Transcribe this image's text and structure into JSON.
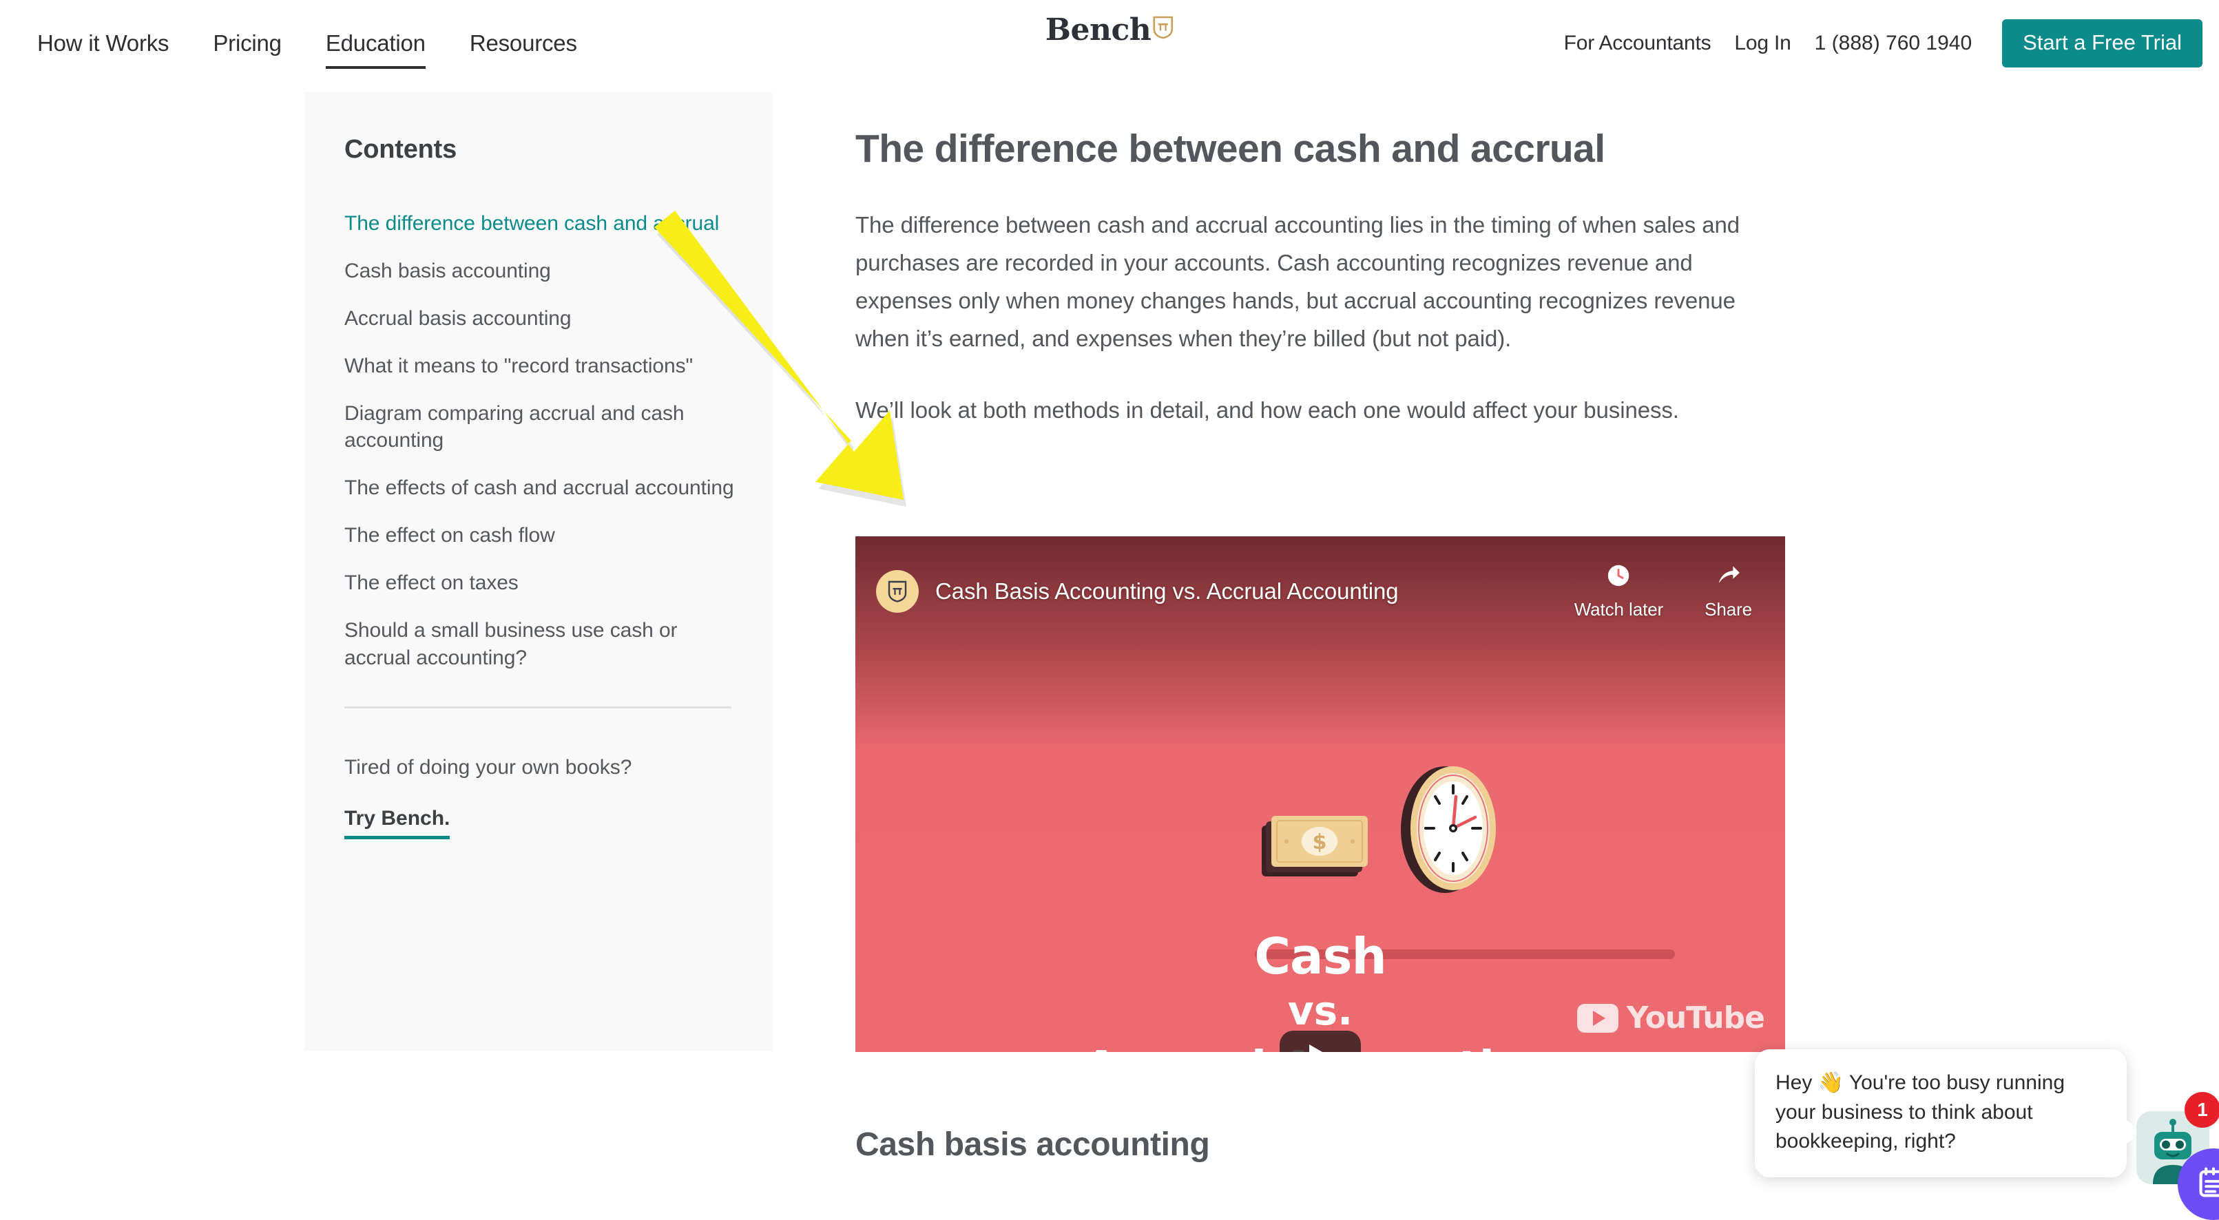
{
  "header": {
    "nav": [
      {
        "label": "How it Works",
        "active": false
      },
      {
        "label": "Pricing",
        "active": false
      },
      {
        "label": "Education",
        "active": true
      },
      {
        "label": "Resources",
        "active": false
      }
    ],
    "brand": {
      "word": "Bench",
      "mark": "bench-shield-pi-icon"
    },
    "right": {
      "for_accountants": "For Accountants",
      "log_in": "Log In",
      "phone": "1 (888) 760 1940",
      "cta": "Start a Free Trial"
    }
  },
  "sidebar": {
    "title": "Contents",
    "items": [
      {
        "label": "The difference between cash and accrual",
        "active": true
      },
      {
        "label": "Cash basis accounting",
        "active": false
      },
      {
        "label": "Accrual basis accounting",
        "active": false
      },
      {
        "label": "What it means to \"record transactions\"",
        "active": false
      },
      {
        "label": "Diagram comparing accrual and cash accounting",
        "active": false
      },
      {
        "label": "The effects of cash and accrual accounting",
        "active": false
      },
      {
        "label": "The effect on cash flow",
        "active": false
      },
      {
        "label": "The effect on taxes",
        "active": false
      },
      {
        "label": "Should a small business use cash or accrual accounting?",
        "active": false
      }
    ],
    "footer_prompt": "Tired of doing your own books?",
    "footer_cta": "Try Bench."
  },
  "article": {
    "h1": "The difference between cash and accrual",
    "p1": "The difference between cash and accrual accounting lies in the timing of when sales and purchases are recorded in your accounts. Cash accounting recognizes revenue and expenses only when money changes hands, but accrual accounting recognizes revenue when it’s earned, and expenses when they’re billed (but not paid).",
    "p2": "We’ll look at both methods in detail, and how each one would affect your business.",
    "h2": "Cash basis accounting"
  },
  "video": {
    "title": "Cash Basis Accounting vs. Accrual Accounting",
    "channel_avatar": "bench-shield-pi-icon",
    "watch_later": "Watch later",
    "watch_later_icon": "clock-icon",
    "share": "Share",
    "share_icon": "share-arrow-icon",
    "play_icon": "play-button-icon",
    "watermark": "YouTube",
    "thumbnail": {
      "line1": "Cash",
      "line2": "vs.",
      "line3": "Accrual Accounting",
      "money_icon": "money-stack-icon",
      "clock_icon": "wall-clock-icon"
    }
  },
  "annotation": {
    "arrow": "yellow-down-left-arrow",
    "color": "#f7ee17"
  },
  "chat": {
    "message": "Hey 👋  You're too busy running your business to think about bookkeeping, right?",
    "avatar_icon": "robot-avatar-icon",
    "badge_count": "1",
    "launcher_icon": "notes-calendar-icon"
  },
  "colors": {
    "accent_teal": "#0d8a8a",
    "brand_gold": "#e6b955",
    "video_red": "#ec6b71",
    "annotation_yellow": "#f7ee17",
    "chat_purple": "#6c4df6",
    "badge_red": "#e8202a"
  }
}
